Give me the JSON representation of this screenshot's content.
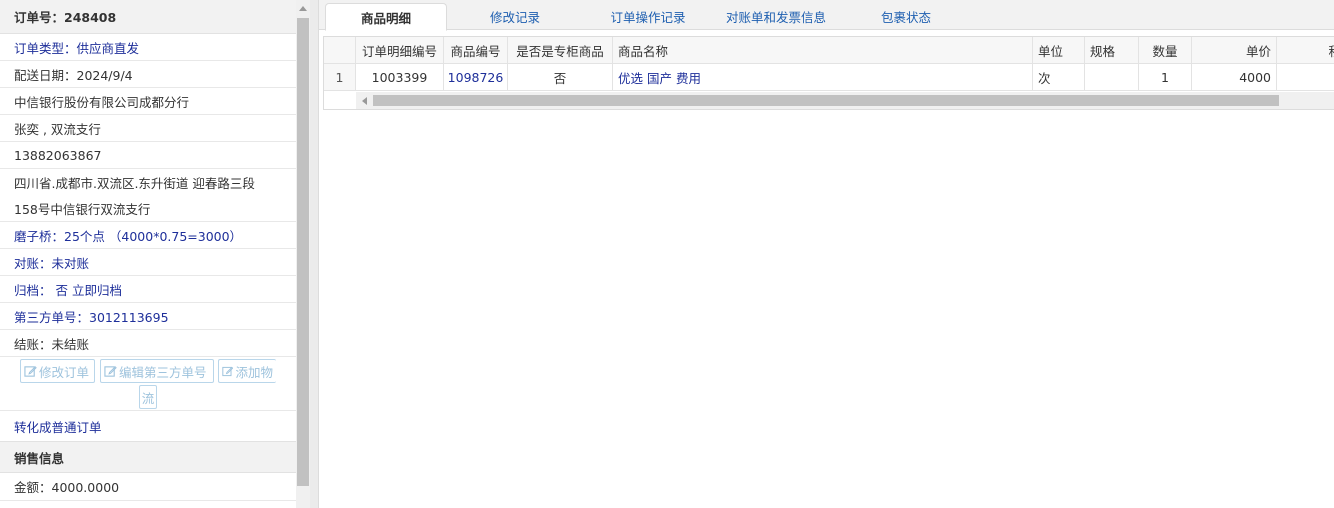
{
  "left_panel": {
    "order_no": "订单号：248408",
    "order_type": "订单类型：供应商直发",
    "delivery_date": "配送日期：2024/9/4",
    "company": "中信银行股份有限公司成都分行",
    "contact": "张奕 , 双流支行",
    "phone": "13882063867",
    "address_line1": "四川省.成都市.双流区.东升街道 迎春路三段",
    "address_line2": "158号中信银行双流支行",
    "points": "磨子桥：25个点 （4000*0.75=3000）",
    "reconcile": "对账：未对账",
    "archive": "归档： 否 立即归档",
    "third_party_no": "第三方单号：3012113695",
    "settlement": "结账：未结账",
    "buttons": {
      "edit_order": "修改订单",
      "edit_third_party": "编辑第三方单号",
      "add_logistics_1": "添加物",
      "add_logistics_2": "流"
    },
    "convert_link": "转化成普通订单",
    "sales_section": "销售信息",
    "amount": "金额：4000.0000"
  },
  "tabs": [
    {
      "label": "商品明细",
      "active": true
    },
    {
      "label": "修改记录",
      "active": false
    },
    {
      "label": "订单操作记录",
      "active": false
    },
    {
      "label": "对账单和发票信息",
      "active": false
    },
    {
      "label": "包裹状态",
      "active": false
    }
  ],
  "grid": {
    "headers": {
      "detail_no": "订单明细编号",
      "product_code": "商品编号",
      "is_cabinet": "是否是专柜商品",
      "product_name": "商品名称",
      "unit": "单位",
      "spec": "规格",
      "qty": "数量",
      "price": "单价",
      "more": "积"
    },
    "rows": [
      {
        "index": "1",
        "detail_no": "1003399",
        "product_code": "1098726",
        "is_cabinet": "否",
        "product_name": "优选 国产 费用",
        "unit": "次",
        "spec": "",
        "qty": "1",
        "price": "4000",
        "more": ""
      }
    ]
  },
  "colors": {
    "link_blue": "#1e2f9a",
    "tab_blue": "#1e5fb0",
    "disabled_button": "#9ec3dd"
  }
}
